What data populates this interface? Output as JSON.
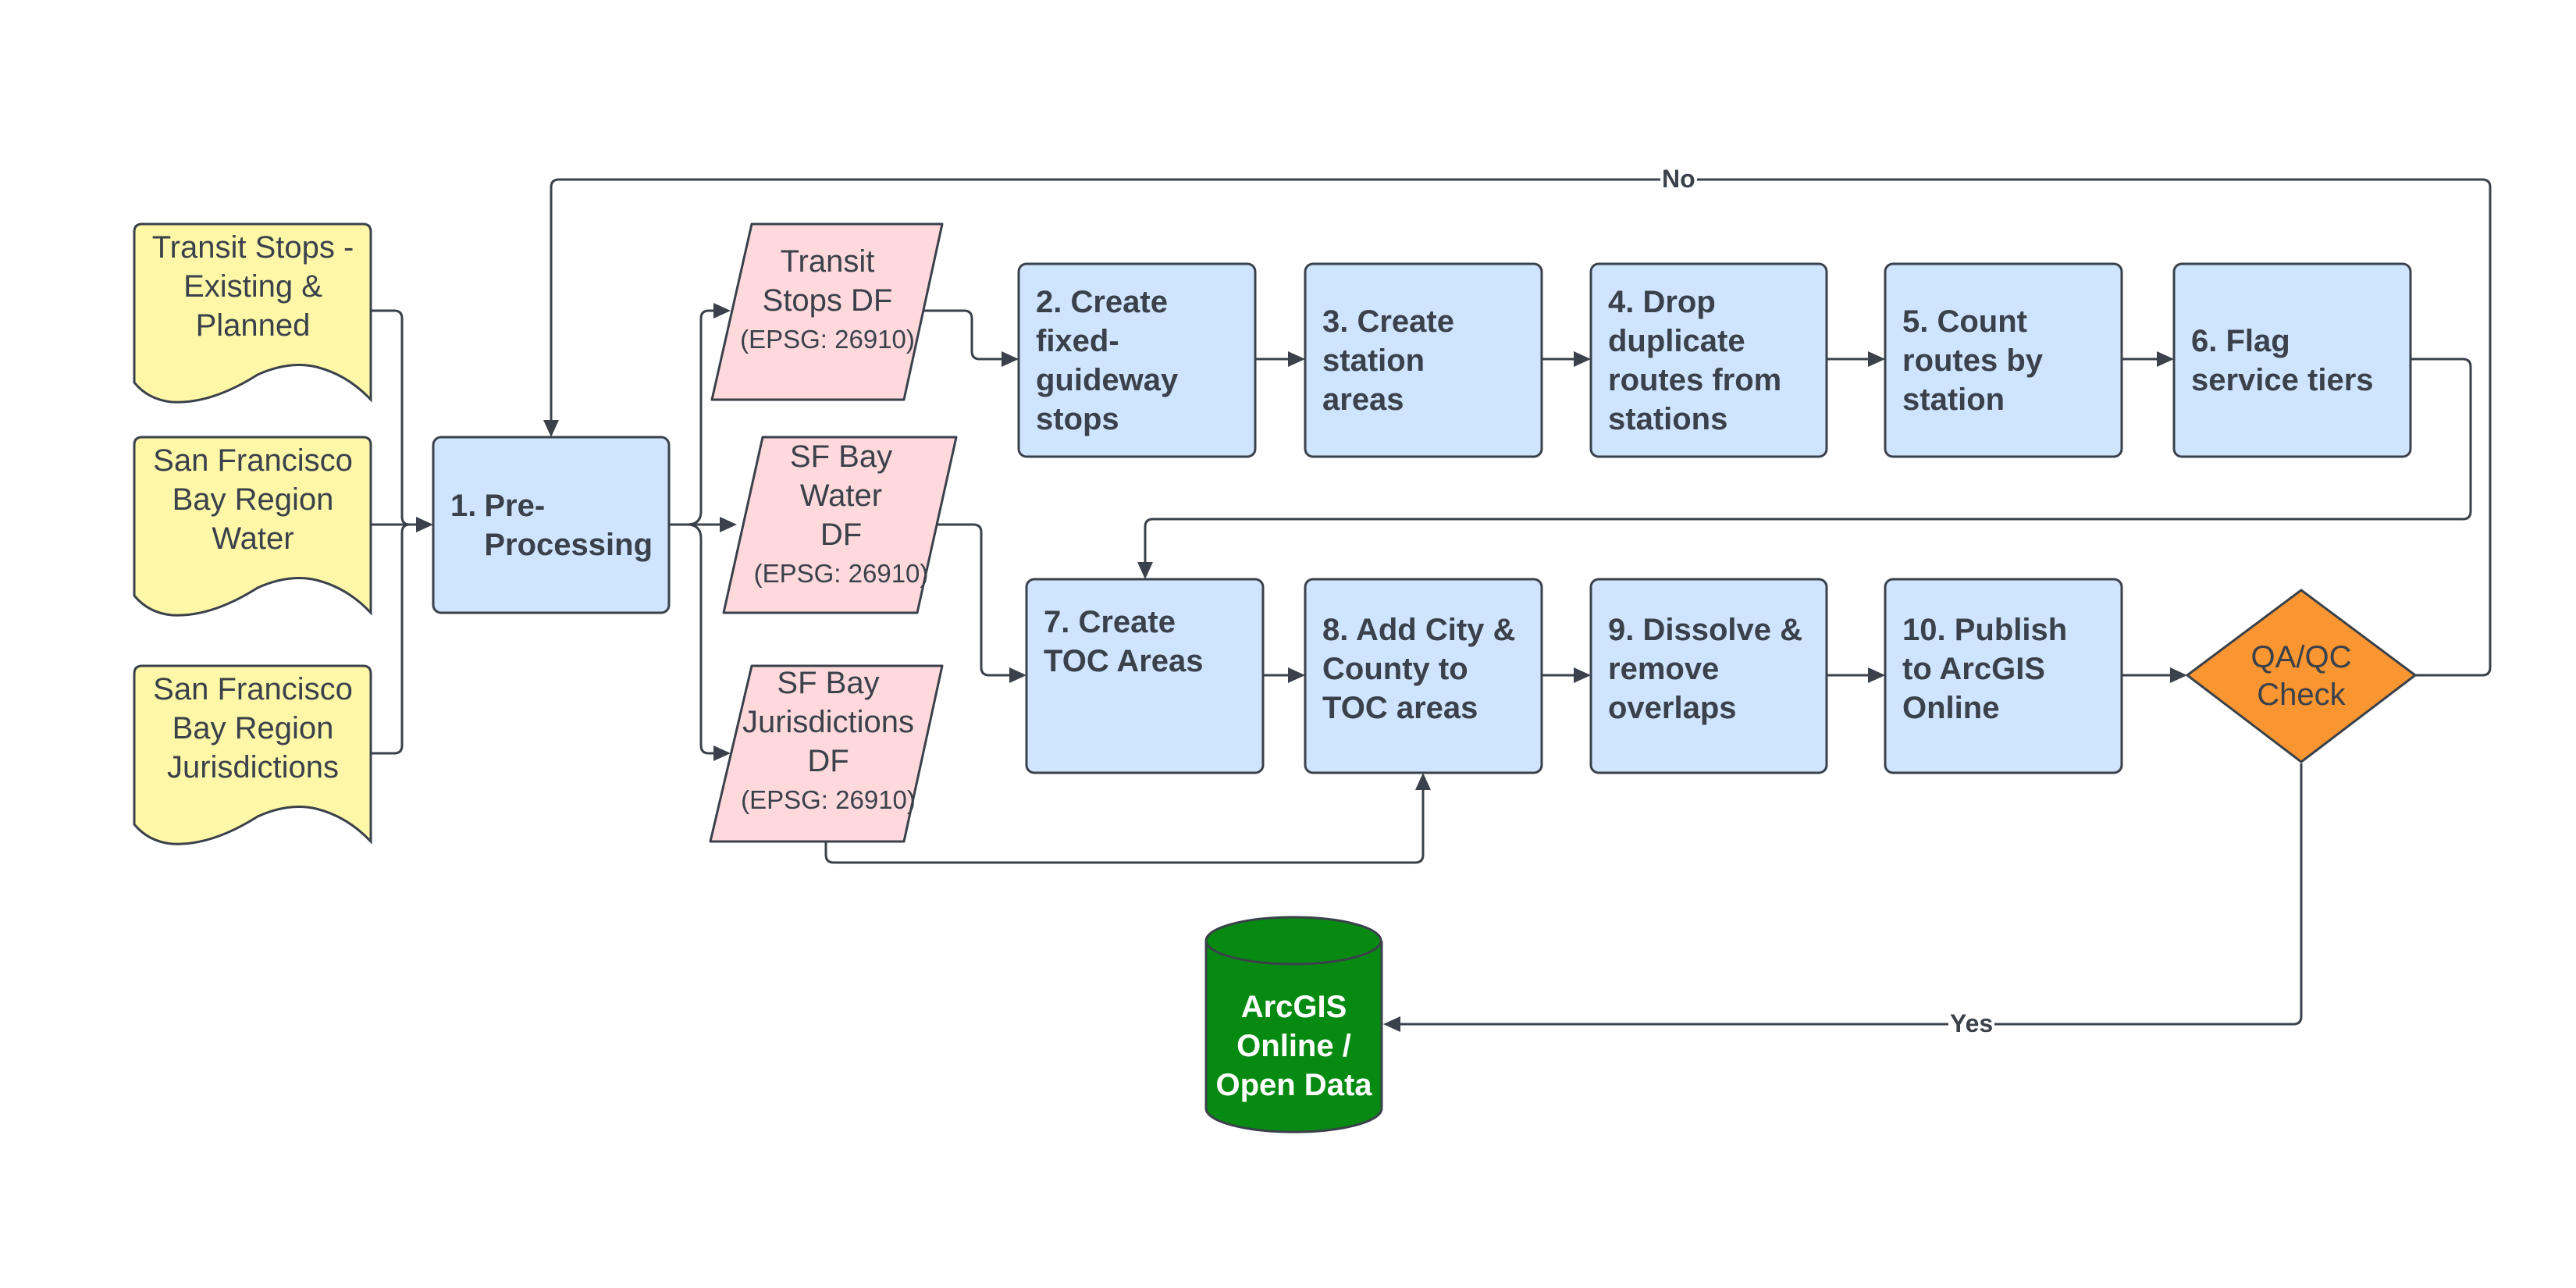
{
  "colors": {
    "input_fill": "#fff7a8",
    "dataframe_fill": "#ffd9dc",
    "process_fill": "#cfe4ff",
    "decision_fill": "#fa9632",
    "database_fill": "#078a12",
    "stroke": "#3a414a"
  },
  "inputs": [
    {
      "id": "transit-stops",
      "label": "Transit Stops - Existing & Planned"
    },
    {
      "id": "bay-water",
      "label": "San Francisco Bay Region Water"
    },
    {
      "id": "bay-jurisdictions",
      "label": "San Francisco Bay Region Jurisdictions"
    }
  ],
  "preprocessing": {
    "number": "1.",
    "label": "Pre-Processing",
    "label_line1": "Pre-",
    "label_line2": "Processing"
  },
  "dataframes": [
    {
      "id": "transit-stops-df",
      "label": "Transit Stops DF",
      "epsg": "(EPSG: 26910)"
    },
    {
      "id": "bay-water-df",
      "label": "SF Bay Water DF",
      "epsg": "(EPSG: 26910)"
    },
    {
      "id": "bay-jurisdictions-df",
      "label": "SF Bay Jurisdictions DF",
      "epsg": "(EPSG: 26910)"
    }
  ],
  "steps": [
    {
      "id": "step-2",
      "label": "2. Create fixed-guideway stops"
    },
    {
      "id": "step-3",
      "label": "3. Create station areas"
    },
    {
      "id": "step-4",
      "label": "4. Drop duplicate routes from stations"
    },
    {
      "id": "step-5",
      "label": "5. Count routes by station"
    },
    {
      "id": "step-6",
      "label": "6. Flag service tiers"
    },
    {
      "id": "step-7",
      "label": "7. Create TOC Areas"
    },
    {
      "id": "step-8",
      "label": "8. Add City & County to TOC areas"
    },
    {
      "id": "step-9",
      "label": "9. Dissolve & remove overlaps"
    },
    {
      "id": "step-10",
      "label": "10. Publish to ArcGIS Online"
    }
  ],
  "decision": {
    "label": "QA/QC Check",
    "yes_label": "Yes",
    "no_label": "No"
  },
  "output": {
    "label": "ArcGIS Online / Open Data"
  }
}
